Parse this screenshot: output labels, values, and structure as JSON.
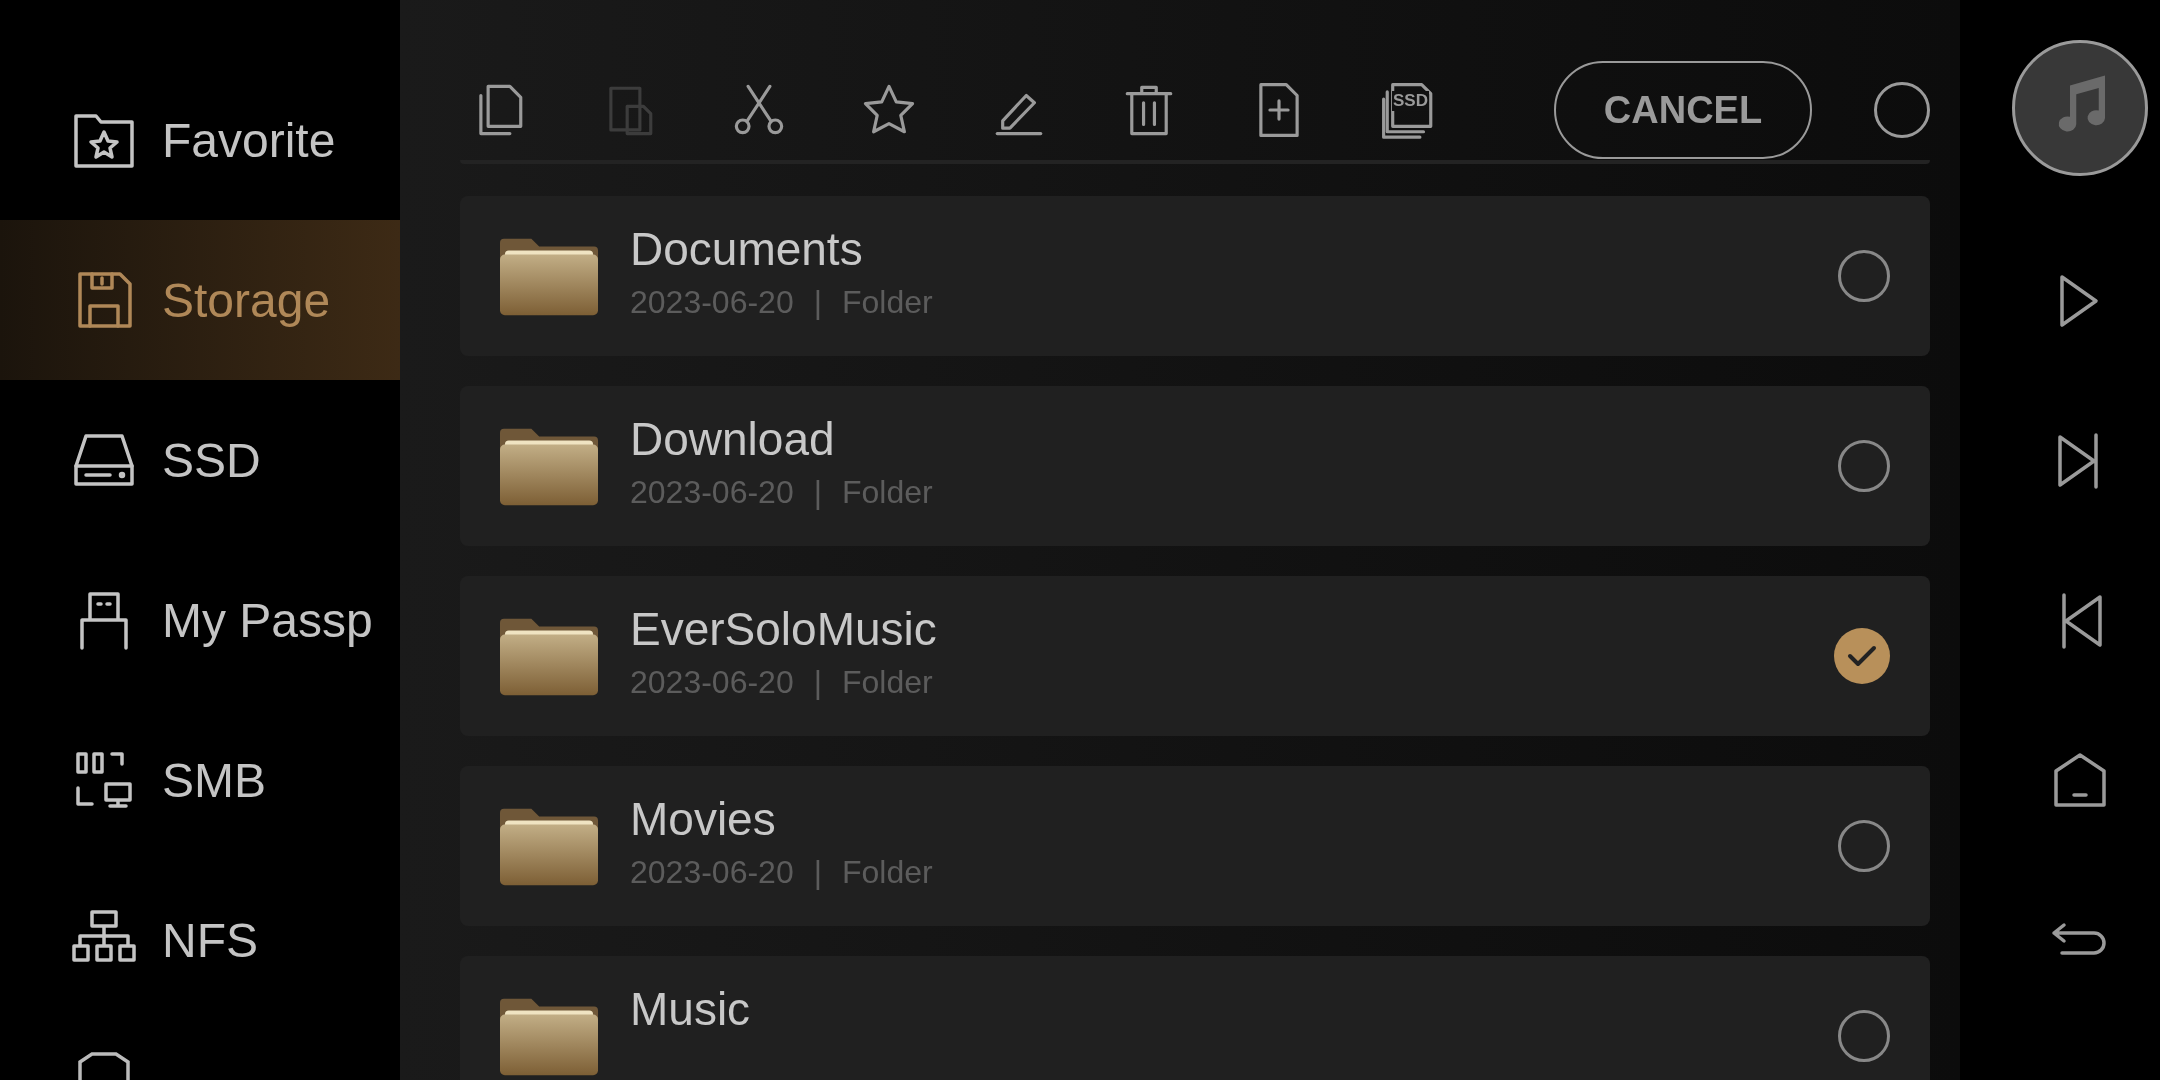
{
  "sidebar": {
    "items": [
      {
        "label": "Favorite",
        "selected": false
      },
      {
        "label": "Storage",
        "selected": true
      },
      {
        "label": "SSD",
        "selected": false
      },
      {
        "label": "My Passp",
        "selected": false
      },
      {
        "label": "SMB",
        "selected": false
      },
      {
        "label": "NFS",
        "selected": false
      }
    ]
  },
  "toolbar": {
    "tools": [
      {
        "kind": "copy",
        "disabled": false
      },
      {
        "kind": "paste",
        "disabled": true
      },
      {
        "kind": "cut",
        "disabled": false
      },
      {
        "kind": "favorite",
        "disabled": false
      },
      {
        "kind": "rename",
        "disabled": false
      },
      {
        "kind": "delete",
        "disabled": false
      },
      {
        "kind": "new",
        "disabled": false
      },
      {
        "kind": "ssd",
        "label": "SSD",
        "disabled": false
      }
    ],
    "cancel": "CANCEL",
    "select_all": {
      "checked": false
    }
  },
  "files": [
    {
      "name": "Documents",
      "date": "2023-06-20",
      "separator": "|",
      "type": "Folder",
      "checked": false
    },
    {
      "name": "Download",
      "date": "2023-06-20",
      "separator": "|",
      "type": "Folder",
      "checked": false
    },
    {
      "name": "EverSoloMusic",
      "date": "2023-06-20",
      "separator": "|",
      "type": "Folder",
      "checked": true
    },
    {
      "name": "Movies",
      "date": "2023-06-20",
      "separator": "|",
      "type": "Folder",
      "checked": false
    },
    {
      "name": "Music",
      "checked": false
    }
  ]
}
